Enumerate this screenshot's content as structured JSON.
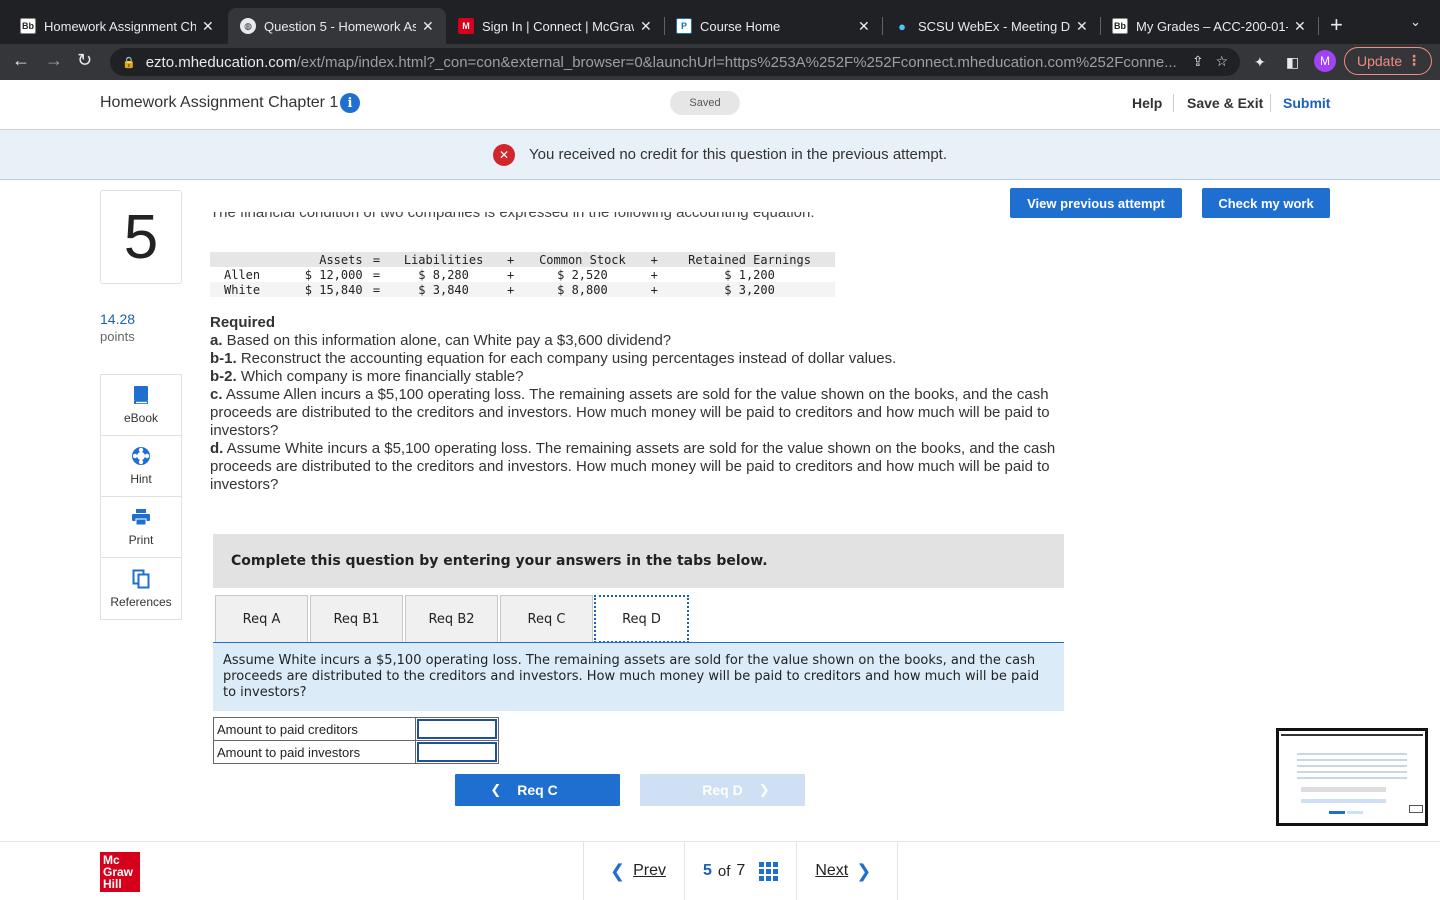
{
  "browser": {
    "tabs": [
      {
        "label": "Homework Assignment Cha",
        "favicon": "Bb"
      },
      {
        "label": "Question 5 - Homework As",
        "favicon": "globe"
      },
      {
        "label": "Sign In | Connect | McGraw",
        "favicon": "M"
      },
      {
        "label": "Course Home",
        "favicon": "P"
      },
      {
        "label": "SCSU WebEx - Meeting De",
        "favicon": "webex"
      },
      {
        "label": "My Grades – ACC-200-01-",
        "favicon": "Bb"
      }
    ],
    "active_tab_index": 1,
    "url_host": "ezto.mheducation.com",
    "url_path": "/ext/map/index.html?_con=con&external_browser=0&launchUrl=https%253A%252F%252Fconnect.mheducation.com%252Fconne...",
    "profile_initial": "M",
    "update_label": "Update"
  },
  "header": {
    "title": "Homework Assignment Chapter 1",
    "saved_label": "Saved",
    "help": "Help",
    "save_exit": "Save & Exit",
    "submit": "Submit"
  },
  "banner": {
    "text": "You received no credit for this question in the previous attempt."
  },
  "question": {
    "number": "5",
    "points_value": "14.28",
    "points_label": "points",
    "intro_cut": "The financial condition of two companies is expressed in the following accounting equation:",
    "table": {
      "headers": [
        "Assets",
        "=",
        "Liabilities",
        "+",
        "Common Stock",
        "+",
        "Retained Earnings"
      ],
      "rows": [
        [
          "Allen",
          "$ 12,000",
          "=",
          "$ 8,280",
          "+",
          "$ 2,520",
          "+",
          "$ 1,200"
        ],
        [
          "White",
          "$ 15,840",
          "=",
          "$ 3,840",
          "+",
          "$ 8,800",
          "+",
          "$ 3,200"
        ]
      ]
    },
    "required_heading": "Required",
    "items": [
      {
        "label": "a.",
        "text": " Based on this information alone, can White pay a $3,600 dividend?"
      },
      {
        "label": "b-1.",
        "text": " Reconstruct the accounting equation for each company using percentages instead of dollar values."
      },
      {
        "label": "b-2.",
        "text": " Which company is more financially stable?"
      },
      {
        "label": "c.",
        "text": " Assume Allen incurs a $5,100 operating loss. The remaining assets are sold for the value shown on the books, and the cash proceeds are distributed to the creditors and investors. How much money will be paid to creditors and how much will be paid to investors?"
      },
      {
        "label": "d.",
        "text": " Assume White incurs a $5,100 operating loss. The remaining assets are sold for the value shown on the books, and the cash proceeds are distributed to the creditors and investors. How much money will be paid to creditors and how much will be paid to investors?"
      }
    ]
  },
  "tools": [
    {
      "label": "eBook",
      "icon": "book-icon"
    },
    {
      "label": "Hint",
      "icon": "lifebuoy-icon"
    },
    {
      "label": "Print",
      "icon": "printer-icon"
    },
    {
      "label": "References",
      "icon": "copy-icon"
    }
  ],
  "actions": {
    "view_previous": "View previous attempt",
    "check_work": "Check my work"
  },
  "answer_panel": {
    "instruction": "Complete this question by entering your answers in the tabs below.",
    "tabs": [
      "Req A",
      "Req B1",
      "Req B2",
      "Req C",
      "Req D"
    ],
    "active_tab": "Req D",
    "description": "Assume White incurs a $5,100 operating loss. The remaining assets are sold for the value shown on the books, and the cash proceeds are distributed to the creditors and investors. How much money will be paid to creditors and how much will be paid to investors?",
    "rows": [
      {
        "label": "Amount to paid creditors",
        "value": ""
      },
      {
        "label": "Amount to paid investors",
        "value": ""
      }
    ],
    "prev_button": "Req C",
    "next_button": "Req D"
  },
  "footer": {
    "logo_text": [
      "Mc",
      "Graw",
      "Hill"
    ],
    "prev": "Prev",
    "current": "5",
    "of": "of",
    "total": "7",
    "next": "Next"
  },
  "colors": {
    "accent": "#1f6fd0",
    "error": "#d0262e",
    "banner_bg": "#e8f0f8",
    "logo_red": "#d6001c"
  }
}
